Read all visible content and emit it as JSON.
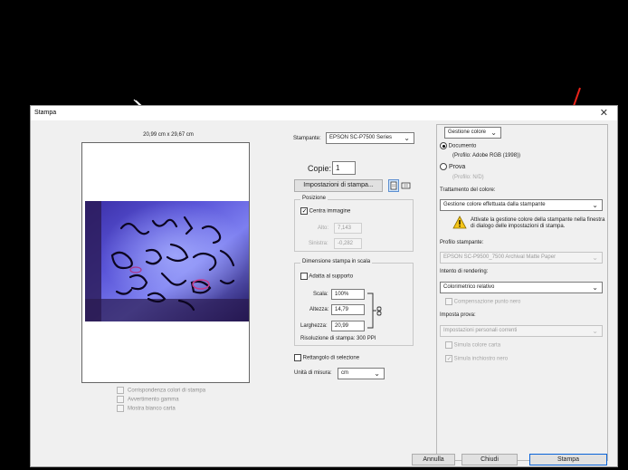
{
  "window": {
    "title": "Stampa",
    "close_glyph": "✕"
  },
  "preview": {
    "paper_size": "20,99 cm x 29,67 cm",
    "checks": [
      {
        "label": "Corrispondenza colori di stampa",
        "checked": false
      },
      {
        "label": "Avvertimento gamma",
        "checked": false
      },
      {
        "label": "Mostra bianco carta",
        "checked": false
      }
    ]
  },
  "printer": {
    "label": "Stampante:",
    "value": "EPSON SC-P7500 Series",
    "copies_label": "Copie:",
    "copies_value": "1",
    "settings_button": "Impostazioni di stampa...",
    "icon1": "page-landscape-icon",
    "icon2": "page-portrait-icon"
  },
  "position": {
    "legend": "Posizione",
    "center_label": "Centra immagine",
    "center_checked": true,
    "top_label": "Alto:",
    "top_value": "7,143",
    "left_label": "Sinistra:",
    "left_value": "-0,282"
  },
  "scaled": {
    "legend": "Dimensione stampa in scala",
    "fit_label": "Adatta al supporto",
    "scale_label": "Scala:",
    "scale_value": "100%",
    "height_label": "Altezza:",
    "height_value": "14,79",
    "width_label": "Larghezza:",
    "width_value": "20,99",
    "resolution": "Risoluzione di stampa: 300 PPI"
  },
  "selection": {
    "label": "Rettangolo di selezione"
  },
  "units": {
    "label": "Unità di misura:",
    "value": "cm"
  },
  "color": {
    "management": "Gestione colore",
    "document_label": "Documento",
    "document_profile": "(Profilo: Adobe RGB (1998))",
    "proof_label": "Prova",
    "proof_profile": "(Profilo: N/D)",
    "handling_label": "Trattamento del colore:",
    "handling_value": "Gestione colore effettuata dalla stampante",
    "warning_text": "Attivate la gestione colore della stampante nella finestra di dialogo delle impostazioni di stampa.",
    "printer_profile_label": "Profilo stampante:",
    "printer_profile_value": "EPSON SC-P9500_7500 Archival Matte Paper",
    "intent_label": "Intento di rendering:",
    "intent_value": "Colorimetrico relativo",
    "bpc_label": "Compensazione punto nero",
    "proof_setup_label": "Imposta prova:",
    "proof_setup_value": "Impostazioni personali correnti",
    "simulate_paper": "Simula colore carta",
    "simulate_ink": "Simula inchiostro nero"
  },
  "buttons": {
    "cancel": "Annulla",
    "done": "Chiudi",
    "print": "Stampa"
  },
  "accent_colors": {
    "red_arrow": "#e8231a",
    "primary_border": "#0a64d8"
  }
}
